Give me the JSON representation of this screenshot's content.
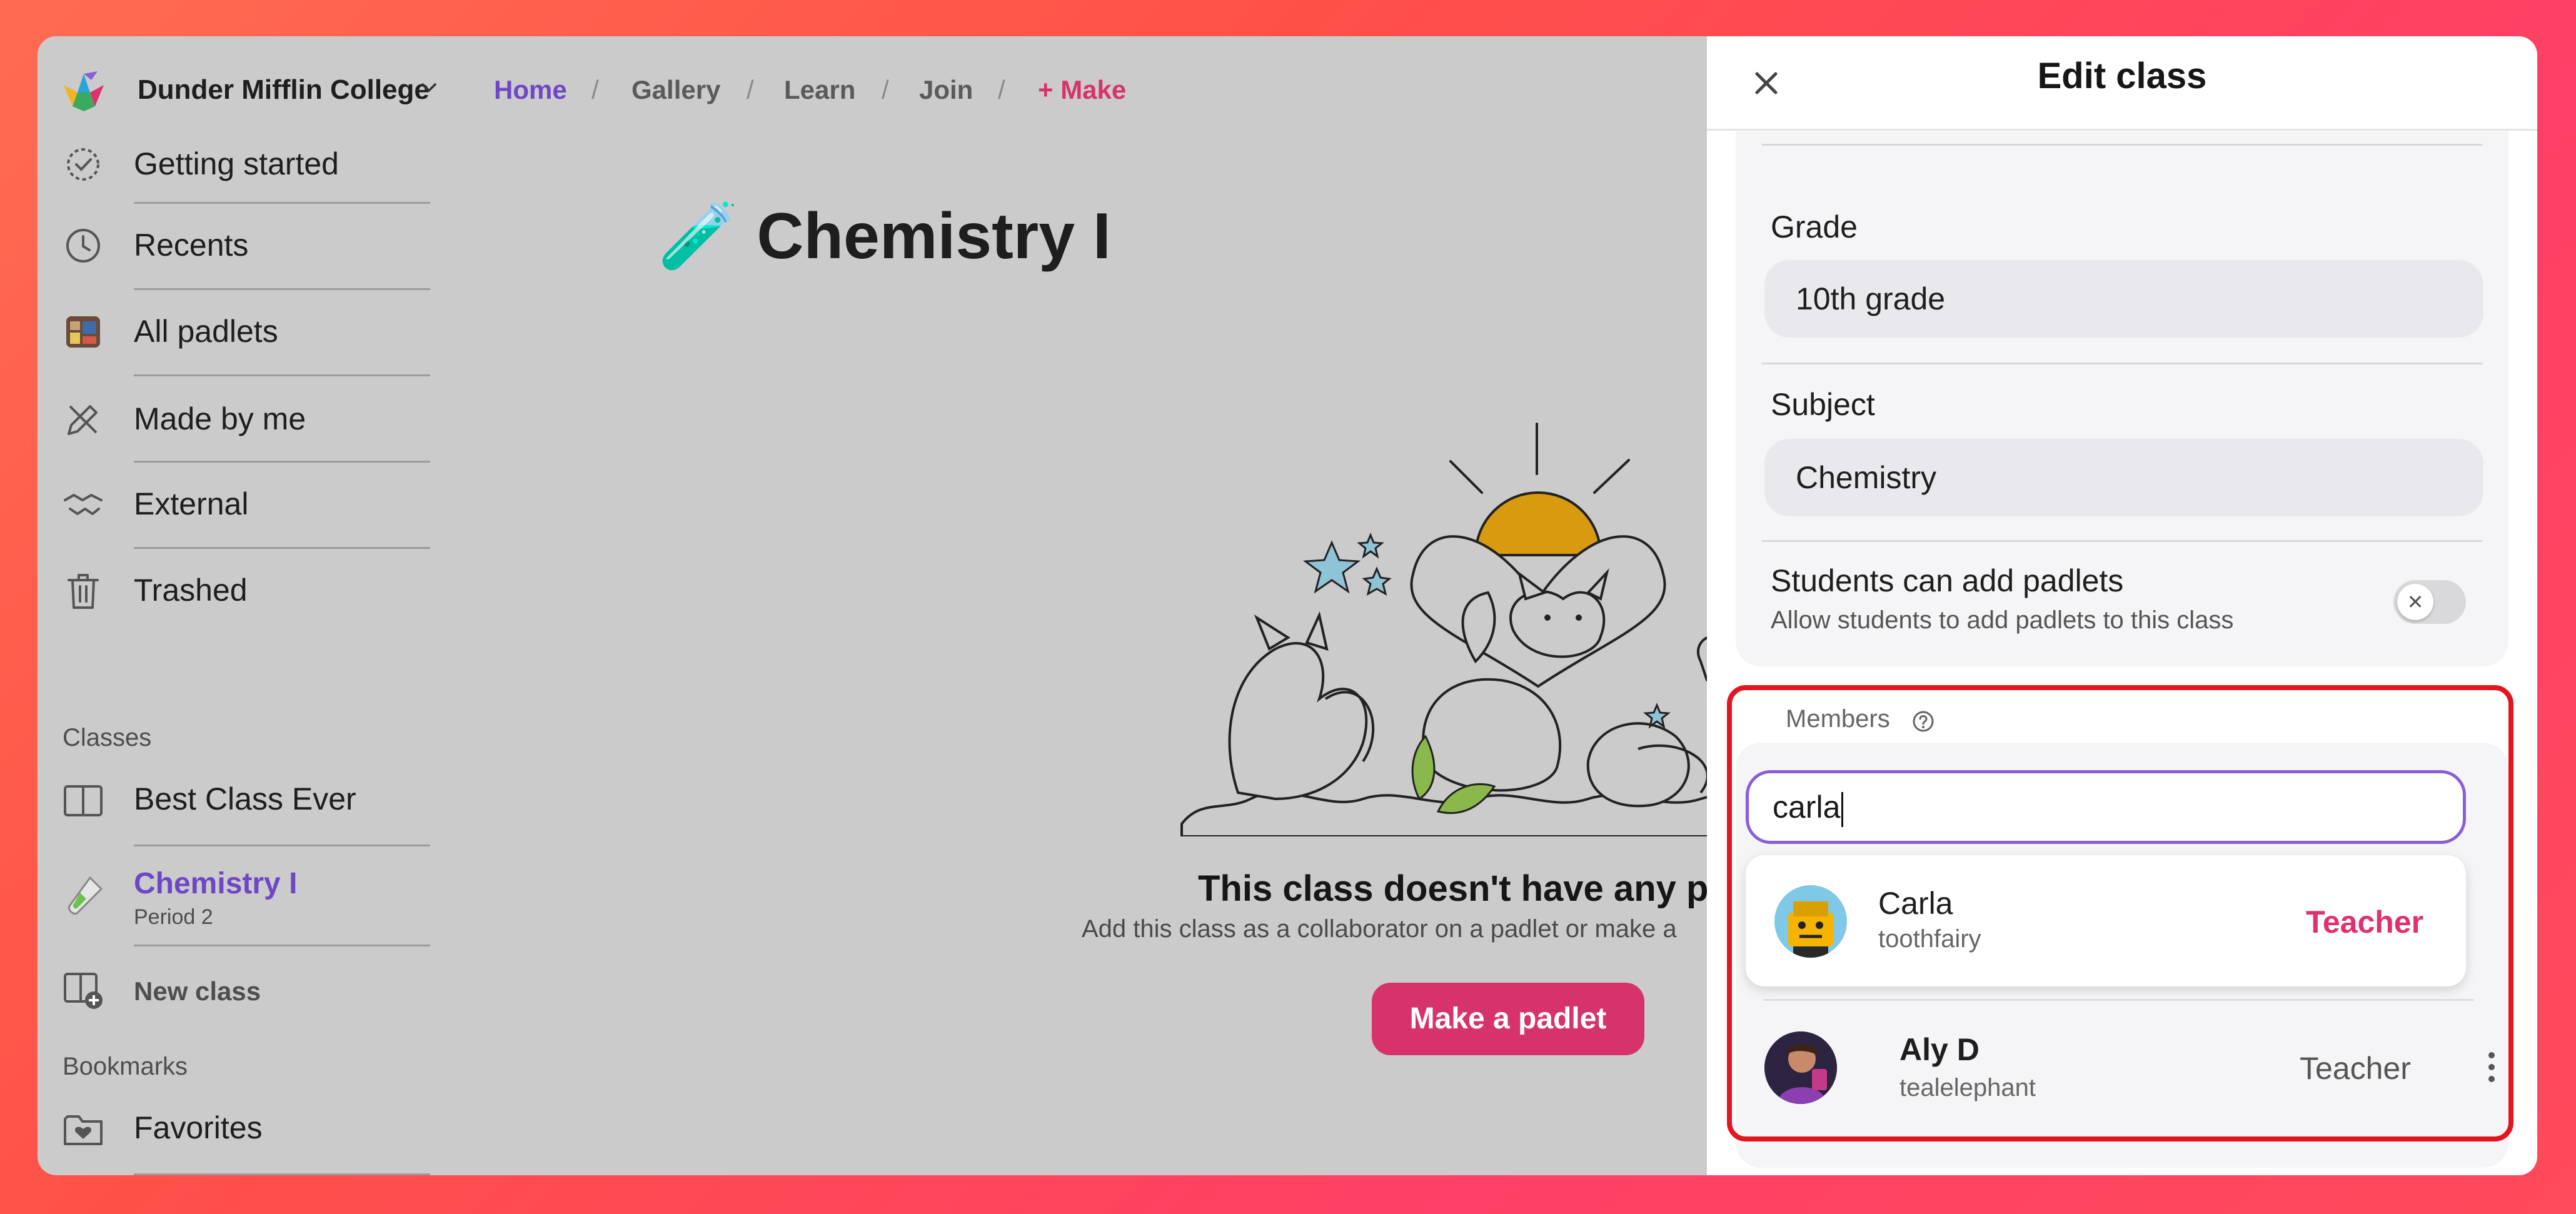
{
  "topbar": {
    "org_name": "Dunder Mifflin College",
    "nav": [
      {
        "label": "Home"
      },
      {
        "label": "Gallery"
      },
      {
        "label": "Learn"
      },
      {
        "label": "Join"
      },
      {
        "label": "+ Make"
      }
    ],
    "separator": "/"
  },
  "sidebar": {
    "items": [
      {
        "label": "Getting started",
        "icon": "check-circle-icon"
      },
      {
        "label": "Recents",
        "icon": "clock-icon"
      },
      {
        "label": "All padlets",
        "icon": "padlets-thumbnail-icon"
      },
      {
        "label": "Made by me",
        "icon": "pencil-ruler-icon"
      },
      {
        "label": "External",
        "icon": "handshake-icon"
      },
      {
        "label": "Trashed",
        "icon": "trash-icon"
      }
    ],
    "classes_title": "Classes",
    "classes": [
      {
        "label": "Best Class Ever",
        "icon": "book-icon"
      },
      {
        "label": "Chemistry I",
        "sub": "Period 2",
        "icon": "test-tube-icon"
      }
    ],
    "new_class_label": "New class",
    "bookmarks_title": "Bookmarks",
    "bookmarks": [
      {
        "label": "Favorites",
        "icon": "folder-heart-icon"
      }
    ]
  },
  "main": {
    "class_title": "Chemistry I",
    "class_emoji": "🧪",
    "empty_title": "This class doesn't have any pa",
    "empty_subtitle": "Add this class as a collaborator on a padlet or make a",
    "make_button": "Make a padlet",
    "illustration": "cat-and-fox-under-sun-illustration"
  },
  "edit_panel": {
    "title": "Edit class",
    "grade_label": "Grade",
    "grade_value": "10th grade",
    "subject_label": "Subject",
    "subject_value": "Chemistry",
    "toggle_label": "Students can add padlets",
    "toggle_sub": "Allow students to add padlets to this class",
    "toggle_on": false,
    "members_label": "Members",
    "search_value": "carla",
    "suggestion": {
      "name": "Carla",
      "username": "toothfairy",
      "role": "Teacher"
    },
    "members": [
      {
        "name": "Aly D",
        "username": "tealelephant",
        "role": "Teacher"
      }
    ]
  },
  "colors": {
    "accent_purple": "#6f47c6",
    "accent_pink": "#d6336c",
    "highlight_red": "#e3151f"
  }
}
